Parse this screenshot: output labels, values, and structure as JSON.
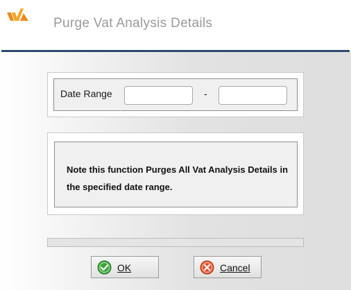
{
  "window": {
    "title": "Purge Vat Analysis Details",
    "logo_icon": "brand-logo-icon"
  },
  "date_range": {
    "label": "Date Range",
    "from_value": "",
    "to_value": "",
    "separator": "-"
  },
  "note": {
    "text": "Note this function Purges All Vat Analysis Details in the specified date range."
  },
  "progress": {
    "value_percent": 0
  },
  "buttons": {
    "ok_label": "OK",
    "ok_icon": "check-circle-icon",
    "cancel_label": "Cancel",
    "cancel_icon": "x-circle-icon"
  },
  "colors": {
    "header_rule": "#2b4a6f",
    "ok_icon": "#3aa53a",
    "cancel_icon": "#e5532d",
    "logo_orange": "#f5a623"
  }
}
